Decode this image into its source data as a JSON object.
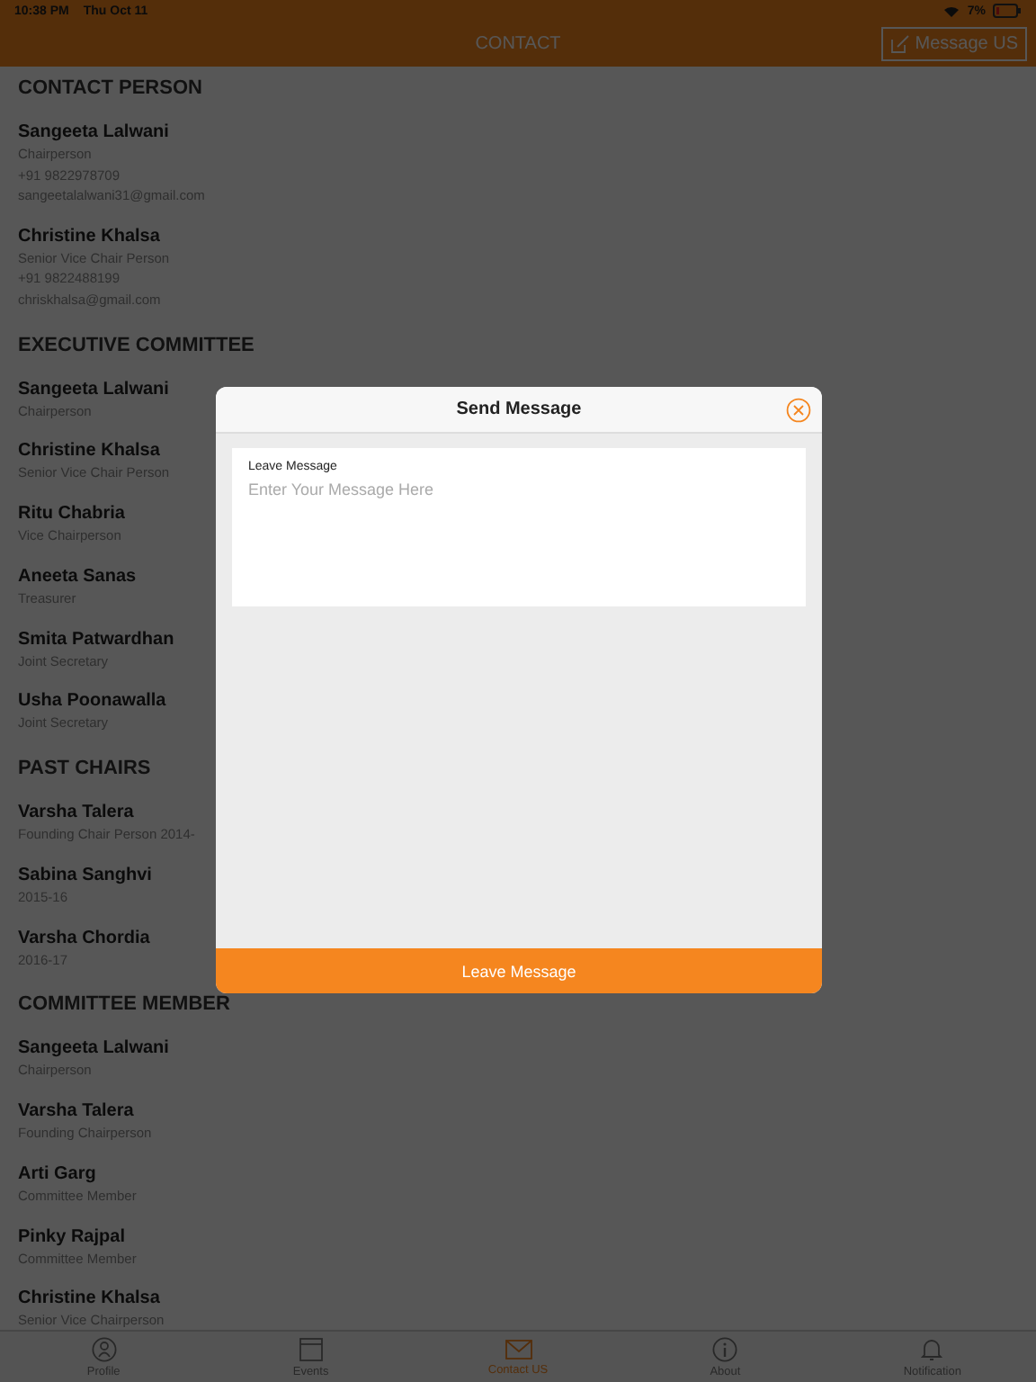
{
  "status_bar": {
    "time": "10:38 PM",
    "date": "Thu Oct 11",
    "battery": "7%"
  },
  "nav": {
    "title": "CONTACT",
    "action": "Message US"
  },
  "sections": [
    {
      "title": "CONTACT PERSON",
      "people": [
        {
          "name": "Sangeeta Lalwani",
          "lines": [
            "Chairperson",
            "+91 9822978709",
            "sangeetalalwani31@gmail.com"
          ]
        },
        {
          "name": "Christine Khalsa",
          "lines": [
            "Senior Vice Chair Person",
            "+91 9822488199",
            "chriskhalsa@gmail.com"
          ]
        }
      ]
    },
    {
      "title": "EXECUTIVE COMMITTEE",
      "people": [
        {
          "name": "Sangeeta Lalwani",
          "lines": [
            "Chairperson"
          ]
        },
        {
          "name": "Christine Khalsa",
          "lines": [
            "Senior Vice Chair Person"
          ]
        },
        {
          "name": "Ritu Chabria",
          "lines": [
            "Vice Chairperson"
          ]
        },
        {
          "name": "Aneeta Sanas",
          "lines": [
            "Treasurer"
          ]
        },
        {
          "name": "Smita Patwardhan",
          "lines": [
            "Joint Secretary"
          ]
        },
        {
          "name": "Usha Poonawalla",
          "lines": [
            "Joint Secretary"
          ]
        }
      ]
    },
    {
      "title": "PAST CHAIRS",
      "people": [
        {
          "name": "Varsha Talera",
          "lines": [
            "Founding Chair Person 2014-"
          ]
        },
        {
          "name": "Sabina Sanghvi",
          "lines": [
            "2015-16"
          ]
        },
        {
          "name": "Varsha Chordia",
          "lines": [
            "2016-17"
          ]
        }
      ]
    },
    {
      "title": "COMMITTEE MEMBER",
      "people": [
        {
          "name": "Sangeeta Lalwani",
          "lines": [
            "Chairperson"
          ]
        },
        {
          "name": "Varsha Talera",
          "lines": [
            "Founding Chairperson"
          ]
        },
        {
          "name": "Arti Garg",
          "lines": [
            "Committee Member"
          ]
        },
        {
          "name": "Pinky Rajpal",
          "lines": [
            "Committee Member"
          ]
        },
        {
          "name": "Christine Khalsa",
          "lines": [
            "Senior Vice Chairperson"
          ]
        }
      ]
    }
  ],
  "dialog": {
    "title": "Send Message",
    "field_label": "Leave Message",
    "placeholder": "Enter Your Message Here",
    "button": "Leave Message"
  },
  "tab_bar": [
    {
      "kind": "profile",
      "label": "Profile",
      "selected": false
    },
    {
      "kind": "events",
      "label": "Events",
      "selected": false
    },
    {
      "kind": "contact",
      "label": "Contact US",
      "selected": true
    },
    {
      "kind": "about",
      "label": "About",
      "selected": false
    },
    {
      "kind": "notification",
      "label": "Notification",
      "selected": false
    }
  ]
}
